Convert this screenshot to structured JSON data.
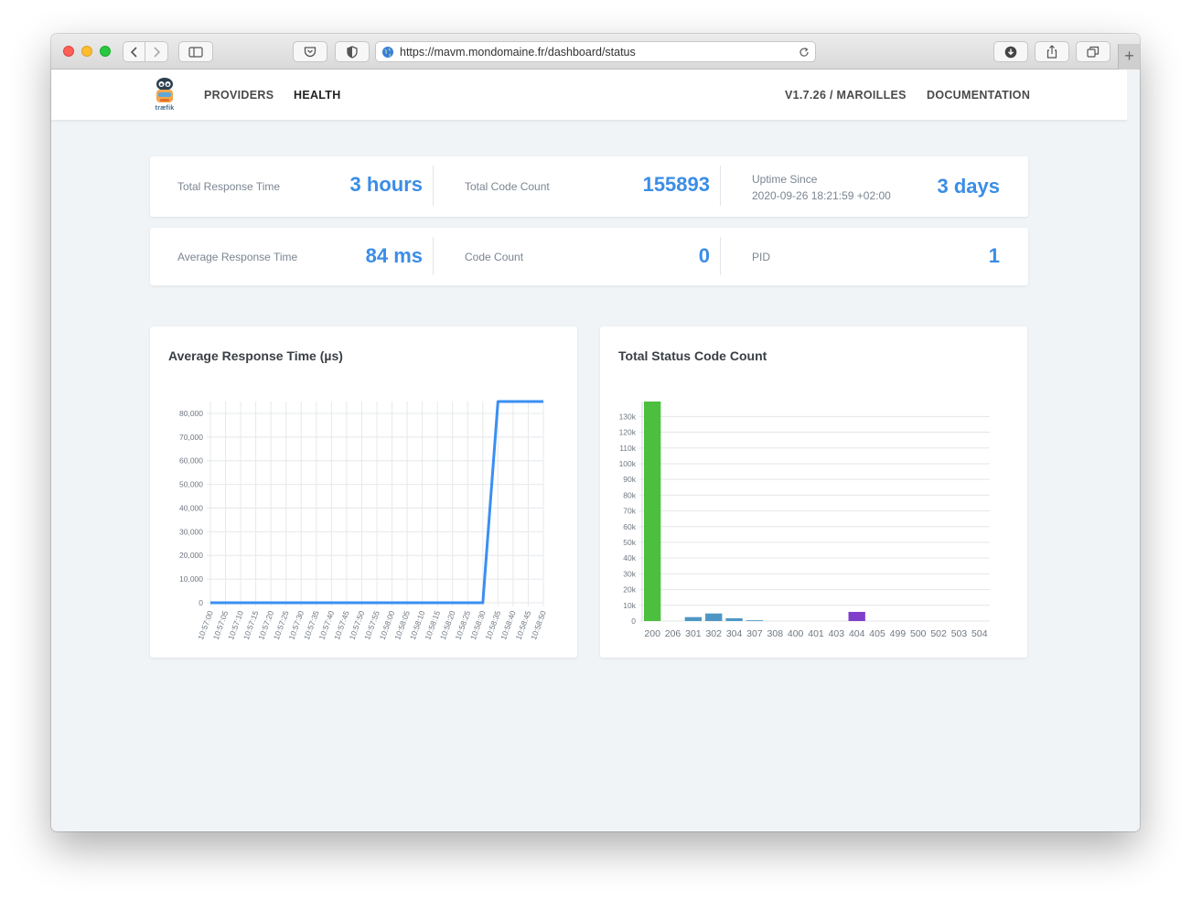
{
  "browser": {
    "url": "https://mavm.mondomaine.fr/dashboard/status"
  },
  "nav": {
    "providers": "PROVIDERS",
    "health": "HEALTH",
    "version": "V1.7.26 / MAROILLES",
    "documentation": "DOCUMENTATION",
    "logo_text": "træfik"
  },
  "stats": {
    "total_response_time": {
      "label": "Total Response Time",
      "value": "3 hours"
    },
    "total_code_count": {
      "label": "Total Code Count",
      "value": "155893"
    },
    "uptime": {
      "label": "Uptime Since",
      "date": "2020-09-26 18:21:59 +02:00",
      "value": "3 days"
    },
    "average_response_time": {
      "label": "Average Response Time",
      "value": "84 ms"
    },
    "code_count": {
      "label": "Code Count",
      "value": "0"
    },
    "pid": {
      "label": "PID",
      "value": "1"
    }
  },
  "colors": {
    "accent": "#3b8de6",
    "line": "#3a8ff2",
    "bar_200": "#4cbf3f",
    "bar_3xx": "#4e97c4",
    "bar_404": "#7f3fcb"
  },
  "chart_data": [
    {
      "type": "line",
      "title": "Average Response Time (µs)",
      "x": [
        "10:57:00",
        "10:57:05",
        "10:57:10",
        "10:57:15",
        "10:57:20",
        "10:57:25",
        "10:57:30",
        "10:57:35",
        "10:57:40",
        "10:57:45",
        "10:57:50",
        "10:57:55",
        "10:58:00",
        "10:58:05",
        "10:58:10",
        "10:58:15",
        "10:58:20",
        "10:58:25",
        "10:58:30",
        "10:58:35",
        "10:58:40",
        "10:58:45",
        "10:58:50"
      ],
      "series": [
        {
          "values": [
            0,
            0,
            0,
            0,
            0,
            0,
            0,
            0,
            0,
            0,
            0,
            0,
            0,
            0,
            0,
            0,
            0,
            0,
            0,
            85000,
            85000,
            85000,
            85000
          ]
        }
      ],
      "ylim": [
        0,
        85000
      ],
      "yticks": [
        0,
        10000,
        20000,
        30000,
        40000,
        50000,
        60000,
        70000,
        80000
      ],
      "ytick_labels": [
        "0",
        "10,000",
        "20,000",
        "30,000",
        "40,000",
        "50,000",
        "60,000",
        "70,000",
        "80,000"
      ],
      "grid": true
    },
    {
      "type": "bar",
      "title": "Total Status Code Count",
      "categories": [
        "200",
        "206",
        "301",
        "302",
        "304",
        "307",
        "308",
        "400",
        "401",
        "403",
        "404",
        "405",
        "499",
        "500",
        "502",
        "503",
        "504"
      ],
      "values": [
        139500,
        0,
        2500,
        4800,
        1800,
        500,
        0,
        0,
        0,
        0,
        5800,
        0,
        0,
        0,
        0,
        0,
        0
      ],
      "ylim": [
        0,
        139500
      ],
      "yticks": [
        0,
        10000,
        20000,
        30000,
        40000,
        50000,
        60000,
        70000,
        80000,
        90000,
        100000,
        110000,
        120000,
        130000
      ],
      "ytick_labels": [
        "0",
        "10k",
        "20k",
        "30k",
        "40k",
        "50k",
        "60k",
        "70k",
        "80k",
        "90k",
        "100k",
        "110k",
        "120k",
        "130k"
      ],
      "grid": true
    }
  ]
}
